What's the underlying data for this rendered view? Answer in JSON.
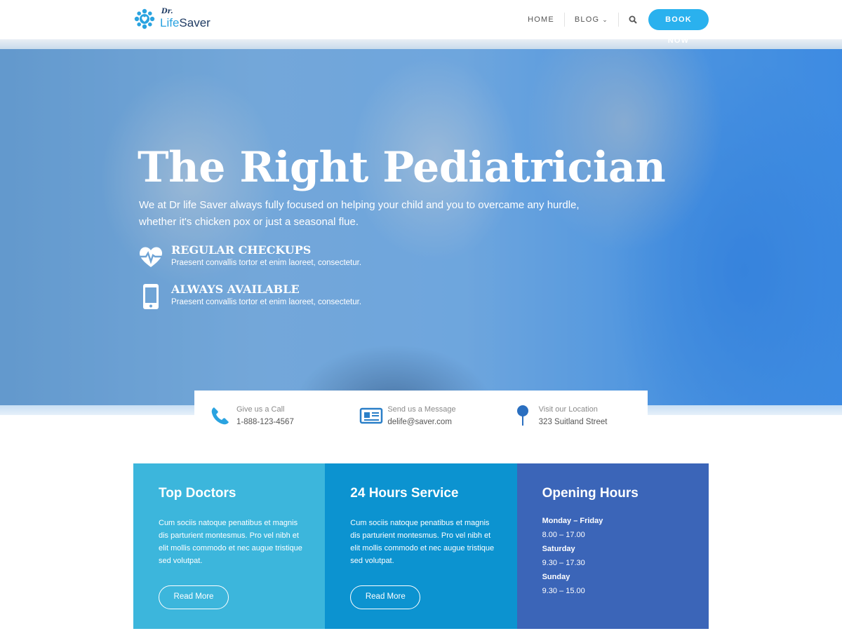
{
  "header": {
    "logo": {
      "dr": "Dr.",
      "name_part1": "Life",
      "name_part2": "Saver"
    },
    "nav": [
      {
        "label": "HOME"
      },
      {
        "label": "BLOG"
      }
    ],
    "book_button": "BOOK NOW"
  },
  "hero": {
    "title": "The Right Pediatrician",
    "subtitle": "We at Dr life Saver always fully focused on helping your child and you to overcame any hurdle, whether it's chicken pox or just a seasonal flue.",
    "features": [
      {
        "icon": "heartbeat-icon",
        "title": "REGULAR CHECKUPS",
        "desc": "Praesent convallis tortor et enim laoreet, consectetur."
      },
      {
        "icon": "mobile-phone-icon",
        "title": "ALWAYS AVAILABLE",
        "desc": "Praesent convallis tortor et enim laoreet, consectetur."
      }
    ]
  },
  "contact": [
    {
      "icon": "phone-icon",
      "label": "Give us a Call",
      "value": "1-888-123-4567"
    },
    {
      "icon": "newspaper-icon",
      "label": "Send us a Message",
      "value": "delife@saver.com"
    },
    {
      "icon": "map-pin-icon",
      "label": "Visit our Location",
      "value": "323 Suitland Street"
    }
  ],
  "boxes": [
    {
      "title": "Top Doctors",
      "text": "Cum sociis natoque penatibus et magnis dis parturient montesmus. Pro vel nibh et elit mollis commodo et nec augue tristique sed volutpat.",
      "button": "Read More"
    },
    {
      "title": "24 Hours Service",
      "text": "Cum sociis natoque penatibus et magnis dis parturient montesmus. Pro vel nibh et elit mollis commodo et nec augue tristique sed volutpat.",
      "button": "Read More"
    },
    {
      "title": "Opening Hours",
      "hours": [
        {
          "day": "Monday – Friday",
          "time": "8.00 – 17.00"
        },
        {
          "day": "Saturday",
          "time": "9.30 – 17.30"
        },
        {
          "day": "Sunday",
          "time": "9.30 – 15.00"
        }
      ]
    }
  ],
  "colors": {
    "accent": "#2ab1ee",
    "box_1": "#3cb6dc",
    "box_2": "#0c93d0",
    "box_3": "#3b65b8",
    "logo_dark": "#1f3b63"
  }
}
